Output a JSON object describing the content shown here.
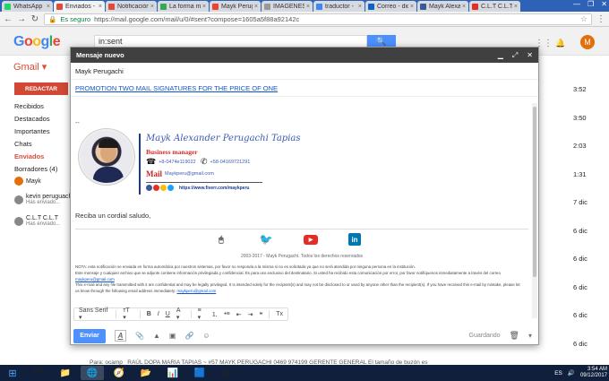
{
  "tabs": [
    {
      "label": "WhatsApp",
      "color": "#25d366",
      "active": false
    },
    {
      "label": "Enviados - mau",
      "color": "#dd4b39",
      "active": true
    },
    {
      "label": "Notificación",
      "color": "#dd4b39",
      "active": false
    },
    {
      "label": "La forma más",
      "color": "#34a853",
      "active": false
    },
    {
      "label": "Mayk Peruga",
      "color": "#ea4335",
      "active": false
    },
    {
      "label": "IMAGENES",
      "color": "#999999",
      "active": false
    },
    {
      "label": "traductor -",
      "color": "#4285f4",
      "active": false
    },
    {
      "label": "Correo - dic",
      "color": "#0a64c8",
      "active": false
    },
    {
      "label": "Mayk Alexa",
      "color": "#3b5998",
      "active": false
    },
    {
      "label": "C.L.T C.L.T",
      "color": "#e52d27",
      "active": false
    }
  ],
  "addressbar": {
    "secure": "Es seguro",
    "url": "https://mail.google.com/mail/u/0/#sent?compose=1605a5f88a92142c"
  },
  "gmail": {
    "logo": [
      "G",
      "o",
      "o",
      "g",
      "l",
      "e"
    ],
    "search_value": "in:sent",
    "avatar_letter": "M",
    "label": "Gmail ▾",
    "compose_label": "REDACTAR",
    "nav": [
      "Recibidos",
      "Destacados",
      "Importantes",
      "Chats",
      "Enviados",
      "Borradores (4)"
    ],
    "hangouts_user": "Mayk",
    "hangouts": [
      {
        "name": "kevin peruguach",
        "sub": "Has enviado..."
      },
      {
        "name": "C.L.T C.L.T",
        "sub": "Has enviado..."
      }
    ],
    "times": [
      "3:52",
      "3:50",
      "2:03",
      "1:31",
      "7 dic",
      "6 dic",
      "6 dic",
      "6 dic",
      "6 dic",
      "6 dic"
    ],
    "last_row": {
      "sender": "Para: ocamp",
      "text": "RAÚL DOPA MARIA TAPIAS ~ #57 MAYK PERUGACHI 0469 974199 GERENTE GENERAL El tamaño de buzón es"
    }
  },
  "compose": {
    "title": "Mensaje nuevo",
    "to": "Mayk Perugachi",
    "subject": "PROMOTION TWO MAIL SIGNATURES FOR THE PRICE OF ONE",
    "dash": "--",
    "signature": {
      "name": "Mayk Alexander Perugachi Tapias",
      "role": "Business manager",
      "phone1": "+8-0474e119022",
      "phone2": "+58-04169721291",
      "mail_logo": "Mail",
      "email": "Maykperu@gmail.com",
      "url": "https://www.fiverr.com/maykperu"
    },
    "greeting": "Reciba un cordial saludo,",
    "social": [
      {
        "name": "mouse-icon",
        "glyph": "🖱"
      },
      {
        "name": "twitter-icon",
        "glyph": "🐦"
      },
      {
        "name": "youtube-icon",
        "glyph": "▶"
      },
      {
        "name": "linkedin-icon",
        "glyph": "in"
      }
    ],
    "copyright": "2003-2017 - Mayk Perugachi. Todos los derechos reservados",
    "notice": {
      "line1": "NOTA: esta notificación se enviada en forma automática por nuestros sistemas, por favor no responda a la misma si no es solicitada ya que no será atendida por ninguna persona en la institución.",
      "line2": "Este mensaje y cualquier archivo que se adjunte contiene información privilegiada y confidencial. Es para uso exclusivo del destinatario. Si usted ha recibido esta comunicación por error, por favor notifíquenos inmediatamente a través del correo",
      "email1": "maykperu@gmail.com",
      "line3": "This e-mail and any file transmitted with it are confidential and may be legally privileged. It is intended solely for the recipient(s) and may not be disclosed to or used by anyone other than the recipient(s). If you have received this e-mail by mistake, please let us know through the following email address immediately:",
      "email2": "maykperu@gmail.com"
    },
    "toolbar": {
      "font": "Sans Serif ▾",
      "size": "тT ▾",
      "bold": "B",
      "italic": "I",
      "underline": "U",
      "color": "A ▾",
      "align": "≡ ▾",
      "ol": "⒈",
      "ul": "•≡",
      "indent_less": "⇤",
      "indent_more": "⇥",
      "quote": "❝",
      "clear": "Tx"
    },
    "send_label": "Enviar",
    "saving": "Guardando"
  },
  "taskbar": {
    "start": "⊞",
    "apps": [
      "🗂",
      "📁",
      "🌐",
      "🧭",
      "📂",
      "📊",
      "🟦",
      "🖼"
    ],
    "lang": "ES",
    "time": "3:54 AM",
    "date": "09/12/2017"
  }
}
